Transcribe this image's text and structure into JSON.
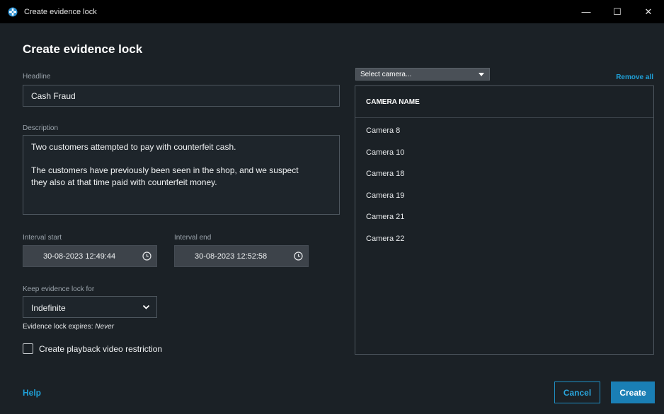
{
  "window": {
    "title": "Create evidence lock",
    "controls": {
      "minimize": "—",
      "maximize": "☐",
      "close": "✕"
    }
  },
  "dialog": {
    "title": "Create evidence lock"
  },
  "form": {
    "headline_label": "Headline",
    "headline_value": "Cash Fraud",
    "description_label": "Description",
    "description_lines": [
      "Two customers attempted to pay with counterfeit cash.",
      "The customers have previously been seen in the shop, and we suspect",
      "they also at that time paid with counterfeit money."
    ],
    "interval_start_label": "Interval start",
    "interval_start_value": "30-08-2023 12:49:44",
    "interval_end_label": "Interval end",
    "interval_end_value": "30-08-2023 12:52:58",
    "keep_label": "Keep evidence lock for",
    "keep_value": "Indefinite",
    "expires_prefix": "Evidence lock expires:",
    "expires_value": "Never",
    "playback_restriction_label": "Create playback video restriction"
  },
  "cameras": {
    "select_placeholder": "Select camera...",
    "remove_all": "Remove all",
    "column_header": "CAMERA NAME",
    "items": [
      "Camera 8",
      "Camera 10",
      "Camera 18",
      "Camera 19",
      "Camera 21",
      "Camera 22"
    ]
  },
  "footer": {
    "help": "Help",
    "cancel": "Cancel",
    "create": "Create"
  },
  "colors": {
    "accent": "#1f9fd6",
    "primary_button": "#1a7fb5",
    "background": "#1b2126",
    "titlebar": "#000000"
  },
  "icons": {
    "app": "app-logo-icon",
    "clock": "clock-icon",
    "dropdown": "chevron-down-icon",
    "camera_dropdown": "caret-down-icon"
  }
}
